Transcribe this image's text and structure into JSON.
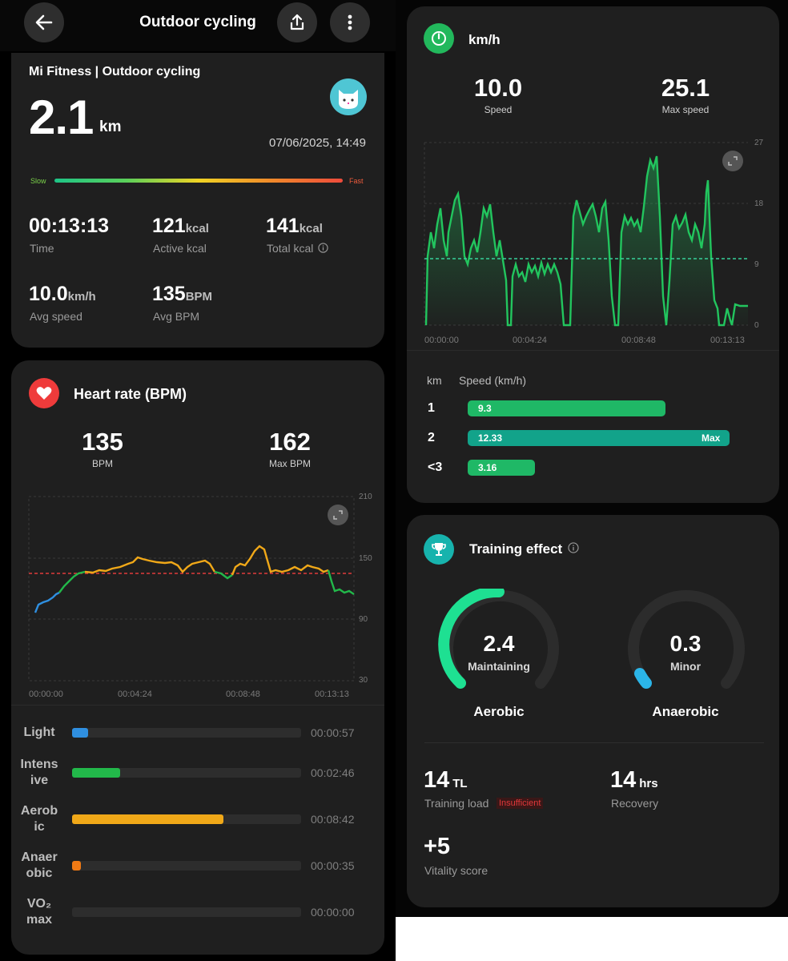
{
  "header": {
    "title": "Outdoor cycling"
  },
  "summary": {
    "source": "Mi Fitness | Outdoor cycling",
    "distance": "2.1",
    "distance_unit": "km",
    "datetime": "07/06/2025, 14:49",
    "slow_label": "Slow",
    "fast_label": "Fast",
    "stats": {
      "time": {
        "value": "00:13:13",
        "label": "Time"
      },
      "active_kcal": {
        "value": "121",
        "unit": "kcal",
        "label": "Active kcal"
      },
      "total_kcal": {
        "value": "141",
        "unit": "kcal",
        "label": "Total kcal"
      },
      "avg_speed": {
        "value": "10.0",
        "unit": "km/h",
        "label": "Avg speed"
      },
      "avg_bpm": {
        "value": "135",
        "unit": "BPM",
        "label": "Avg BPM"
      }
    }
  },
  "heart_rate": {
    "title": "Heart rate (BPM)",
    "avg_value": "135",
    "avg_label": "BPM",
    "max_value": "162",
    "max_label": "Max BPM",
    "y_ticks": [
      "210",
      "150",
      "90",
      "30"
    ],
    "x_ticks": [
      "00:00:00",
      "00:04:24",
      "00:08:48",
      "00:13:13"
    ],
    "zones": [
      {
        "name": "Light",
        "time": "00:00:57",
        "fraction": 0.07,
        "color": "#2f8fe0"
      },
      {
        "name": "Intens ive",
        "time": "00:02:46",
        "fraction": 0.21,
        "color": "#22b84a"
      },
      {
        "name": "Aerob ic",
        "time": "00:08:42",
        "fraction": 0.66,
        "color": "#f0a818"
      },
      {
        "name": "Anaer obic",
        "time": "00:00:35",
        "fraction": 0.04,
        "color": "#f07a14"
      },
      {
        "name": "VO₂ max",
        "time": "00:00:00",
        "fraction": 0,
        "color": "#e03c3c"
      }
    ]
  },
  "speed": {
    "title": "km/h",
    "speed_value": "10.0",
    "speed_label": "Speed",
    "max_value": "25.1",
    "max_label": "Max speed",
    "y_ticks": [
      "27",
      "18",
      "9",
      "0"
    ],
    "x_ticks": [
      "00:00:00",
      "00:04:24",
      "00:08:48",
      "00:13:13"
    ],
    "split_header_km": "km",
    "split_header_speed": "Speed (km/h)",
    "splits": [
      {
        "km": "1",
        "speed": "9.3",
        "max_label": ""
      },
      {
        "km": "2",
        "speed": "12.33",
        "max_label": "Max"
      },
      {
        "km": "<3",
        "speed": "3.16",
        "max_label": ""
      }
    ]
  },
  "training": {
    "title": "Training effect",
    "aerobic": {
      "value": "2.4",
      "status": "Maintaining",
      "label": "Aerobic",
      "level": 2.4
    },
    "anaerobic": {
      "value": "0.3",
      "status": "Minor",
      "label": "Anaerobic",
      "level": 0.3
    },
    "training_load": {
      "value": "14",
      "unit": "TL",
      "label": "Training load",
      "badge": "Insufficient"
    },
    "recovery": {
      "value": "14",
      "unit": "hrs",
      "label": "Recovery"
    },
    "vitality": {
      "value": "+5",
      "label": "Vitality score"
    }
  }
}
